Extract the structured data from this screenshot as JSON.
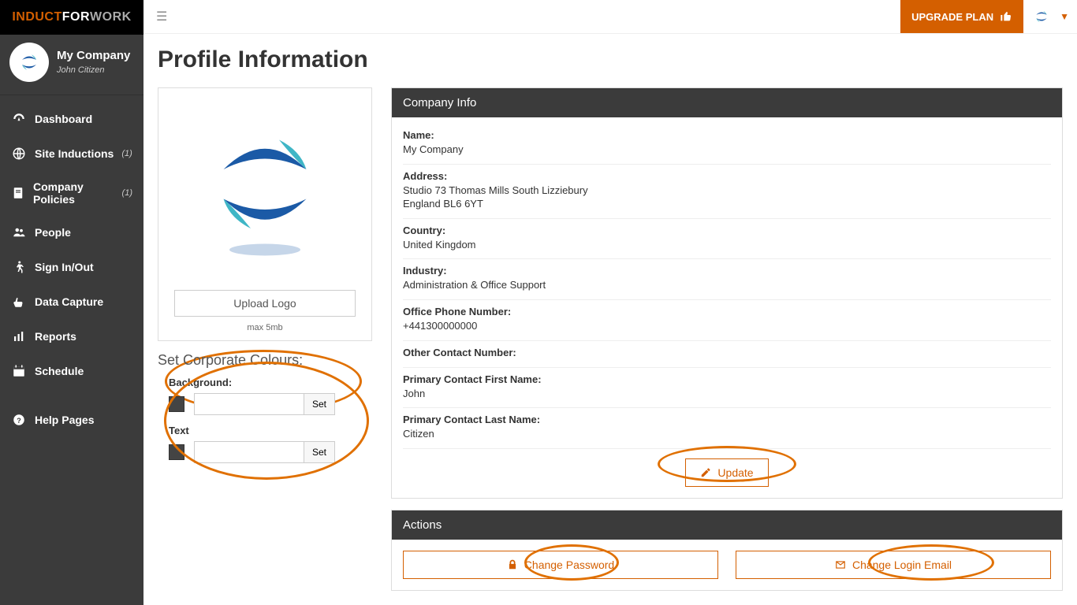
{
  "brand": {
    "part1": "INDUCT",
    "part2": "FOR",
    "part3": " WORK"
  },
  "company_block": {
    "company": "My Company",
    "user": "John Citizen"
  },
  "sidebar": {
    "items": [
      {
        "label": "Dashboard"
      },
      {
        "label": "Site Inductions",
        "badge": "(1)"
      },
      {
        "label": "Company Policies",
        "badge": "(1)"
      },
      {
        "label": "People"
      },
      {
        "label": "Sign In/Out"
      },
      {
        "label": "Data Capture"
      },
      {
        "label": "Reports"
      },
      {
        "label": "Schedule"
      },
      {
        "label": "Help Pages"
      }
    ]
  },
  "topbar": {
    "upgrade": "UPGRADE PLAN"
  },
  "page": {
    "title": "Profile Information"
  },
  "logo_panel": {
    "upload_button": "Upload Logo",
    "max_note": "max 5mb"
  },
  "corp_colours": {
    "heading": "Set Corporate Colours:",
    "background_label": "Background:",
    "text_label": "Text",
    "set_button": "Set",
    "background_value": "",
    "text_value": ""
  },
  "company_info": {
    "heading": "Company Info",
    "rows": {
      "name": {
        "label": "Name:",
        "value": "My Company"
      },
      "address": {
        "label": "Address:",
        "value": "Studio 73 Thomas Mills South Lizziebury\nEngland BL6 6YT"
      },
      "country": {
        "label": "Country:",
        "value": "United Kingdom"
      },
      "industry": {
        "label": "Industry:",
        "value": "Administration & Office Support"
      },
      "office_phone": {
        "label": "Office Phone Number:",
        "value": "+441300000000"
      },
      "other_contact": {
        "label": "Other Contact Number:",
        "value": ""
      },
      "first_name": {
        "label": "Primary Contact First Name:",
        "value": "John"
      },
      "last_name": {
        "label": "Primary Contact Last Name:",
        "value": "Citizen"
      }
    },
    "update_button": "Update"
  },
  "actions": {
    "heading": "Actions",
    "change_password": "Change Password",
    "change_email": "Change Login Email"
  }
}
